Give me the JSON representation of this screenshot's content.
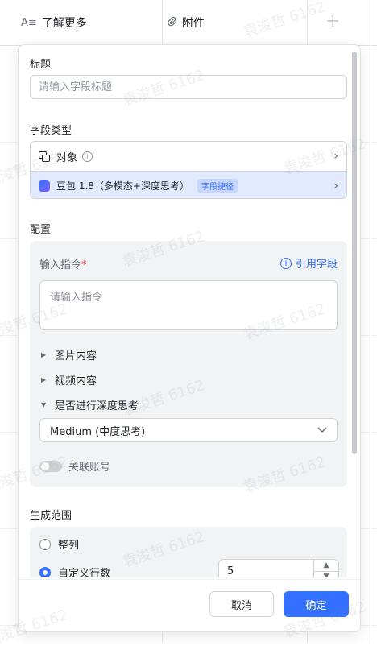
{
  "table_header": {
    "col1_icon": "A≡",
    "col1_label": "了解更多",
    "col2_icon": "paperclip-icon",
    "col2_label": "附件",
    "add_column": "+"
  },
  "watermark": "袁浚哲 6162",
  "form": {
    "title_label": "标题",
    "title_placeholder": "请输入字段标题",
    "field_type_label": "字段类型",
    "field_type": {
      "object_label": "对象",
      "model_label": "豆包 1.8（多模态+深度思考）",
      "model_badge": "字段捷径"
    },
    "config_label": "配置",
    "instruction_label": "输入指令",
    "required_mark": "*",
    "cite_field": "引用字段",
    "instruction_placeholder": "请输入指令",
    "image_content": "图片内容",
    "video_content": "视频内容",
    "deep_think": "是否进行深度思考",
    "deep_think_value": "Medium (中度思考)",
    "link_account": "关联账号",
    "range_label": "生成范围",
    "range_options": [
      "整列",
      "自定义行数"
    ],
    "custom_rows_value": "5"
  },
  "footer": {
    "cancel": "取消",
    "confirm": "确定"
  },
  "colors": {
    "accent": "#3370ff",
    "selected_row": "#e1eaff"
  }
}
